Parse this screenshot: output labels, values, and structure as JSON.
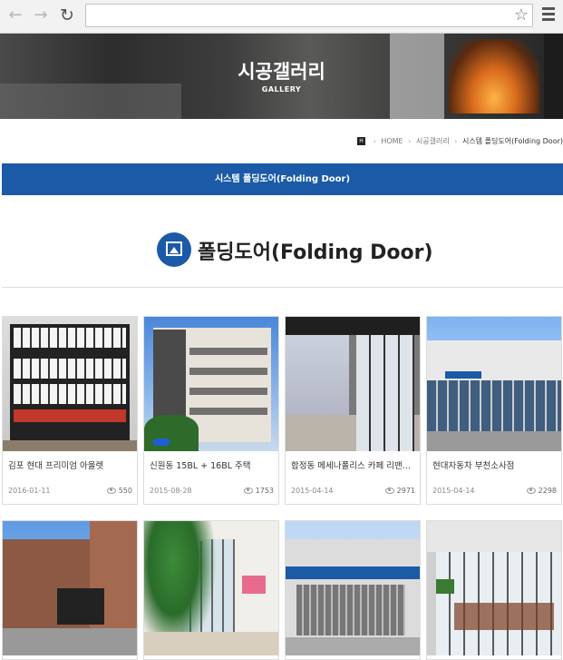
{
  "browser": {
    "address_value": ""
  },
  "banner": {
    "title": "시공갤러리",
    "subtitle": "GALLERY"
  },
  "breadcrumb": {
    "items": [
      "HOME",
      "시공갤러리",
      "시스템 폴딩도어(Folding Door)"
    ]
  },
  "tabs": {
    "active_label": "시스템 폴딩도어(Folding Door)"
  },
  "section": {
    "title": "폴딩도어(Folding Door)"
  },
  "gallery": {
    "items": [
      {
        "title": "김포 현대 프리미엄 아울렛",
        "date": "2016-01-11",
        "views": "550"
      },
      {
        "title": "신원동 15BL + 16BL 주택",
        "date": "2015-08-28",
        "views": "1753"
      },
      {
        "title": "합정동 메세나폴리스 카페 리맨…",
        "date": "2015-04-14",
        "views": "2971"
      },
      {
        "title": "현대자동차 부천소사점",
        "date": "2015-04-14",
        "views": "2298"
      }
    ]
  },
  "colors": {
    "accent": "#1b5aa7"
  }
}
